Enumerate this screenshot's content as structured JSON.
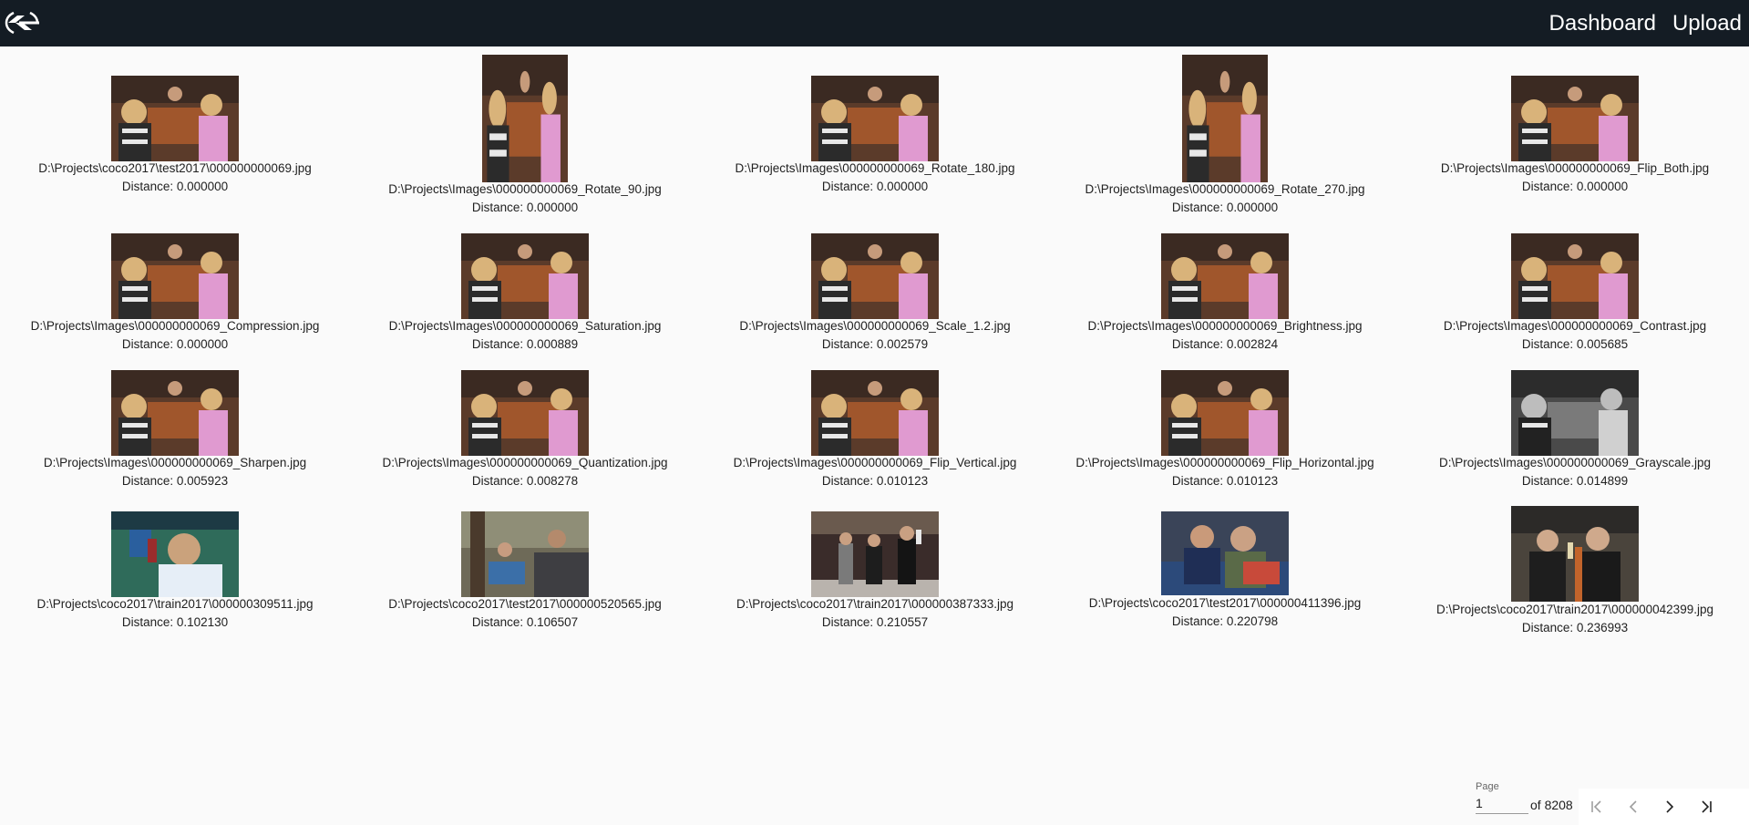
{
  "header": {
    "logo": "logo-icon",
    "nav": [
      {
        "label": "Dashboard"
      },
      {
        "label": "Upload"
      }
    ]
  },
  "results": [
    {
      "path": "D:\\Projects\\coco2017\\test2017\\000000000069.jpg",
      "distance": "Distance: 0.000000"
    },
    {
      "path": "D:\\Projects\\Images\\000000000069_Rotate_90.jpg",
      "distance": "Distance: 0.000000"
    },
    {
      "path": "D:\\Projects\\Images\\000000000069_Rotate_180.jpg",
      "distance": "Distance: 0.000000"
    },
    {
      "path": "D:\\Projects\\Images\\000000000069_Rotate_270.jpg",
      "distance": "Distance: 0.000000"
    },
    {
      "path": "D:\\Projects\\Images\\000000000069_Flip_Both.jpg",
      "distance": "Distance: 0.000000"
    },
    {
      "path": "D:\\Projects\\Images\\000000000069_Compression.jpg",
      "distance": "Distance: 0.000000"
    },
    {
      "path": "D:\\Projects\\Images\\000000000069_Saturation.jpg",
      "distance": "Distance: 0.000889"
    },
    {
      "path": "D:\\Projects\\Images\\000000000069_Scale_1.2.jpg",
      "distance": "Distance: 0.002579"
    },
    {
      "path": "D:\\Projects\\Images\\000000000069_Brightness.jpg",
      "distance": "Distance: 0.002824"
    },
    {
      "path": "D:\\Projects\\Images\\000000000069_Contrast.jpg",
      "distance": "Distance: 0.005685"
    },
    {
      "path": "D:\\Projects\\Images\\000000000069_Sharpen.jpg",
      "distance": "Distance: 0.005923"
    },
    {
      "path": "D:\\Projects\\Images\\000000000069_Quantization.jpg",
      "distance": "Distance: 0.008278"
    },
    {
      "path": "D:\\Projects\\Images\\000000000069_Flip_Vertical.jpg",
      "distance": "Distance: 0.010123"
    },
    {
      "path": "D:\\Projects\\Images\\000000000069_Flip_Horizontal.jpg",
      "distance": "Distance: 0.010123"
    },
    {
      "path": "D:\\Projects\\Images\\000000000069_Grayscale.jpg",
      "distance": "Distance: 0.014899"
    },
    {
      "path": "D:\\Projects\\coco2017\\train2017\\000000309511.jpg",
      "distance": "Distance: 0.102130"
    },
    {
      "path": "D:\\Projects\\coco2017\\test2017\\000000520565.jpg",
      "distance": "Distance: 0.106507"
    },
    {
      "path": "D:\\Projects\\coco2017\\train2017\\000000387333.jpg",
      "distance": "Distance: 0.210557"
    },
    {
      "path": "D:\\Projects\\coco2017\\test2017\\000000411396.jpg",
      "distance": "Distance: 0.220798"
    },
    {
      "path": "D:\\Projects\\coco2017\\train2017\\000000042399.jpg",
      "distance": "Distance: 0.236993"
    }
  ],
  "pager": {
    "page_label": "Page",
    "page_value": "1",
    "of_text": "of 8208",
    "buttons": [
      "first-page-icon",
      "previous-page-icon",
      "next-page-icon",
      "last-page-icon"
    ]
  }
}
